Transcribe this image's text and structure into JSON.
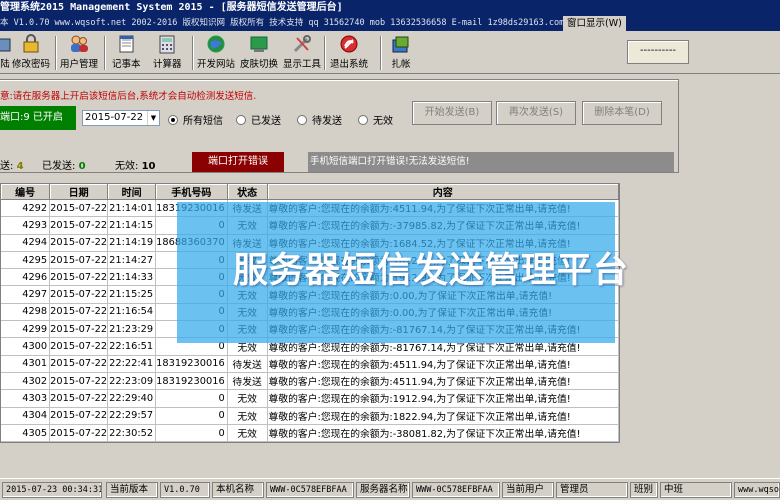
{
  "window": {
    "title": "管理系统2015 Management System 2015 - [服务器短信发送管理后台]",
    "info": "本 V1.0.70  www.wqsoft.net 2002-2016 版权知识网 版权所有 技术支持 qq 31562740 mob 13632536658  E-mail 1z98ds29163.com",
    "window_menu": "窗口显示(W)"
  },
  "toolbar": {
    "items": [
      {
        "label": "陆",
        "icon": "login-icon"
      },
      {
        "label": "修改密码",
        "icon": "key-icon"
      },
      {
        "label": "用户管理",
        "icon": "users-icon"
      },
      {
        "label": "记事本",
        "icon": "notebook-icon"
      },
      {
        "label": "计算器",
        "icon": "calculator-icon"
      },
      {
        "label": "开发网站",
        "icon": "globe-icon"
      },
      {
        "label": "皮肤切换",
        "icon": "skin-icon"
      },
      {
        "label": "显示工具",
        "icon": "tools-icon"
      },
      {
        "label": "退出系统",
        "icon": "exit-icon"
      },
      {
        "label": "扎帐",
        "icon": "ledger-icon"
      }
    ],
    "right_box": "----------"
  },
  "panel": {
    "hint": "意:请在服务器上开启该短信后台,系统才会自动检测发送短信.",
    "port_status": "端口:9 已开启",
    "date": "2015-07-22",
    "filters": [
      "所有短信",
      "已发送",
      "待发送",
      "无效"
    ],
    "selected_filter": "所有短信",
    "buttons": {
      "start": "开始发送(B)",
      "resend": "再次发送(S)",
      "delete": "删除本笔(D)"
    },
    "stats": {
      "pending_label": "送:",
      "pending": "4",
      "sent_label": "已发送:",
      "sent": "0",
      "invalid_label": "无效:",
      "invalid": "10"
    },
    "port_error_button": "端口打开错误",
    "error_message": "手机短信端口打开错误!无法发送短信!"
  },
  "table": {
    "columns": [
      "编号",
      "日期",
      "时间",
      "手机号码",
      "状态",
      "内容"
    ],
    "rows": [
      [
        "4292",
        "2015-07-22",
        "21:14:01",
        "18319230016",
        "待发送",
        "尊敬的客户:您现在的余额为:4511.94,为了保证下次正常出单,请充值!"
      ],
      [
        "4293",
        "2015-07-22",
        "21:14:15",
        "0",
        "无效",
        "尊敬的客户:您现在的余额为:-37985.82,为了保证下次正常出单,请充值!"
      ],
      [
        "4294",
        "2015-07-22",
        "21:14:19",
        "18688360370",
        "待发送",
        "尊敬的客户:您现在的余额为:1684.52,为了保证下次正常出单,请充值!"
      ],
      [
        "4295",
        "2015-07-22",
        "21:14:27",
        "0",
        "无效",
        "尊敬的客户:您现在的余额为:1822.94,为了保证下次正常出单,请充值!"
      ],
      [
        "4296",
        "2015-07-22",
        "21:14:33",
        "0",
        "无效",
        "尊敬的客户:您现在的余额为:1912.94,为了保证下次正常出单,请充值!"
      ],
      [
        "4297",
        "2015-07-22",
        "21:15:25",
        "0",
        "无效",
        "尊敬的客户:您现在的余额为:0.00,为了保证下次正常出单,请充值!"
      ],
      [
        "4298",
        "2015-07-22",
        "21:16:54",
        "0",
        "无效",
        "尊敬的客户:您现在的余额为:0.00,为了保证下次正常出单,请充值!"
      ],
      [
        "4299",
        "2015-07-22",
        "21:23:29",
        "0",
        "无效",
        "尊敬的客户:您现在的余额为:-81767.14,为了保证下次正常出单,请充值!"
      ],
      [
        "4300",
        "2015-07-22",
        "22:16:51",
        "0",
        "无效",
        "尊敬的客户:您现在的余额为:-81767.14,为了保证下次正常出单,请充值!"
      ],
      [
        "4301",
        "2015-07-22",
        "22:22:41",
        "18319230016",
        "待发送",
        "尊敬的客户:您现在的余额为:4511.94,为了保证下次正常出单,请充值!"
      ],
      [
        "4302",
        "2015-07-22",
        "22:23:09",
        "18319230016",
        "待发送",
        "尊敬的客户:您现在的余额为:4511.94,为了保证下次正常出单,请充值!"
      ],
      [
        "4303",
        "2015-07-22",
        "22:29:40",
        "0",
        "无效",
        "尊敬的客户:您现在的余额为:1912.94,为了保证下次正常出单,请充值!"
      ],
      [
        "4304",
        "2015-07-22",
        "22:29:57",
        "0",
        "无效",
        "尊敬的客户:您现在的余额为:1822.94,为了保证下次正常出单,请充值!"
      ],
      [
        "4305",
        "2015-07-22",
        "22:30:52",
        "0",
        "无效",
        "尊敬的客户:您现在的余额为:-38081.82,为了保证下次正常出单,请充值!"
      ]
    ]
  },
  "overlay": {
    "caption": "服务器短信发送管理平台"
  },
  "statusbar": {
    "datetime": "2015-07-23 00:34:31",
    "version_label": "当前版本",
    "version": "V1.0.70",
    "host_label": "本机名称",
    "host": "WWW-0C578EFBFAA",
    "server_label": "服务器名称",
    "server": "WWW-0C578EFBFAA",
    "user_label": "当前用户",
    "user": "管理员",
    "shift_label": "班别",
    "shift": "中班",
    "site": "www.wqsof"
  },
  "colors": {
    "titlebar": "#0a246a",
    "port_ok": "#008000",
    "error": "#8b0000",
    "hint": "#c00000",
    "overlay": "#32aaeb"
  }
}
